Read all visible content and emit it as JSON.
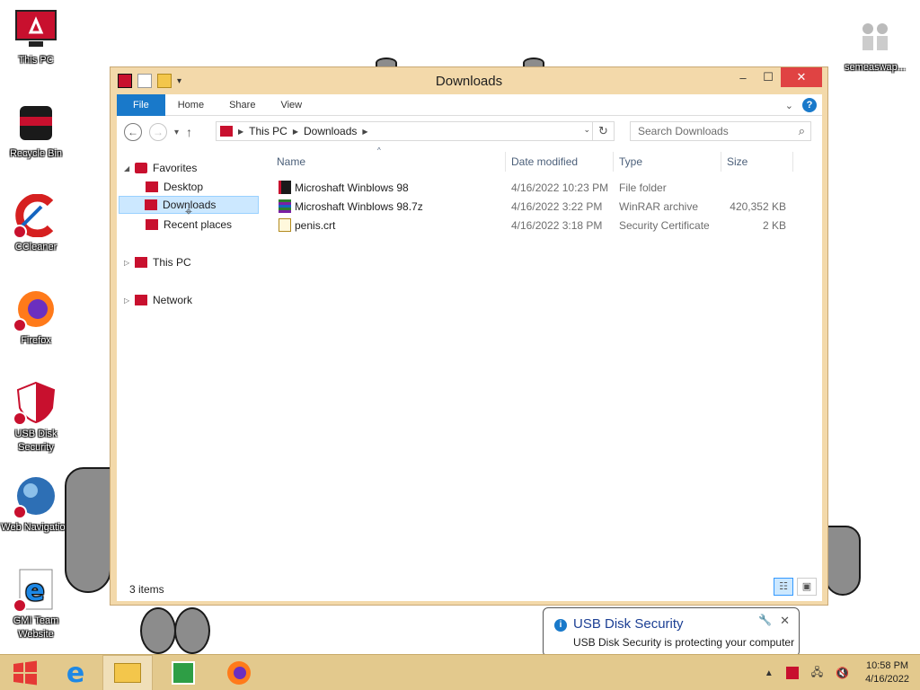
{
  "desktop": {
    "icons": [
      {
        "label": "This PC"
      },
      {
        "label": "Recycle Bin"
      },
      {
        "label": "CCleaner"
      },
      {
        "label": "Firefox"
      },
      {
        "label": "USB Disk Security"
      },
      {
        "label": "Web Navigation"
      },
      {
        "label": "GMI Team Website"
      },
      {
        "label": "semeaswap..."
      }
    ]
  },
  "window": {
    "title": "Downloads",
    "ribbon_tabs": [
      "File",
      "Home",
      "Share",
      "View"
    ],
    "breadcrumb": [
      "This PC",
      "Downloads"
    ],
    "search_placeholder": "Search Downloads",
    "nav_tree": {
      "favorites": "Favorites",
      "desktop": "Desktop",
      "downloads": "Downloads",
      "recent": "Recent places",
      "this_pc": "This PC",
      "network": "Network"
    },
    "columns": [
      "Name",
      "Date modified",
      "Type",
      "Size"
    ],
    "files": [
      {
        "name": "Microshaft Winblows 98",
        "date": "4/16/2022 10:23 PM",
        "type": "File folder",
        "size": ""
      },
      {
        "name": "Microshaft Winblows 98.7z",
        "date": "4/16/2022 3:22 PM",
        "type": "WinRAR archive",
        "size": "420,352 KB"
      },
      {
        "name": "penis.crt",
        "date": "4/16/2022 3:18 PM",
        "type": "Security Certificate",
        "size": "2 KB"
      }
    ],
    "status": "3 items"
  },
  "notification": {
    "title": "USB Disk Security",
    "text": "USB Disk Security is protecting your computer"
  },
  "taskbar": {
    "time": "10:58 PM",
    "date": "4/16/2022"
  },
  "colors": {
    "window_frame": "#f3d9aa",
    "taskbar": "#e3c98d",
    "accent": "#1979ca",
    "close": "#e04343",
    "brand_red": "#c8102e"
  }
}
